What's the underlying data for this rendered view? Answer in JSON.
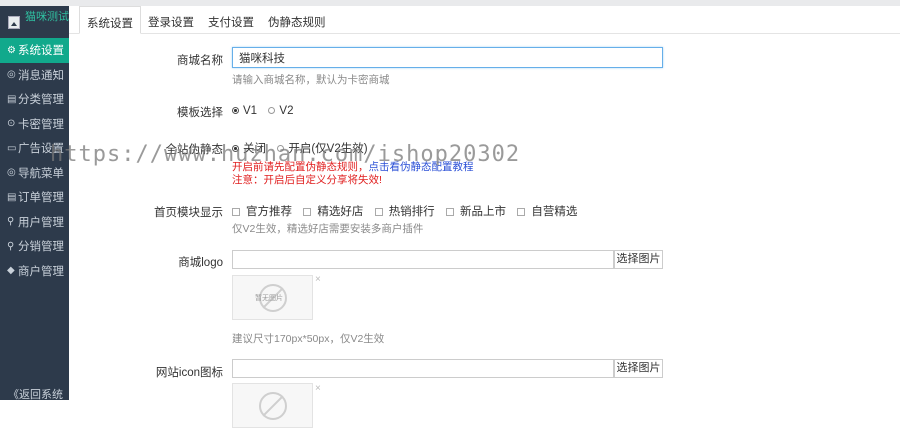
{
  "brand": {
    "name": "猫咪测试"
  },
  "sidebar": {
    "items": [
      {
        "icon": "⚙",
        "label": "系统设置",
        "active": true
      },
      {
        "icon": "◎",
        "label": "消息通知"
      },
      {
        "icon": "▤",
        "label": "分类管理"
      },
      {
        "icon": "⊙",
        "label": "卡密管理"
      },
      {
        "icon": "▭",
        "label": "广告设置"
      },
      {
        "icon": "◎",
        "label": "导航菜单"
      },
      {
        "icon": "▤",
        "label": "订单管理"
      },
      {
        "icon": "⚲",
        "label": "用户管理"
      },
      {
        "icon": "⚲",
        "label": "分销管理"
      },
      {
        "icon": "◆",
        "label": "商户管理"
      }
    ],
    "back_label": "《返回系统"
  },
  "tabs": [
    {
      "label": "系统设置",
      "active": true
    },
    {
      "label": "登录设置"
    },
    {
      "label": "支付设置"
    },
    {
      "label": "伪静态规则"
    }
  ],
  "form": {
    "shop_name": {
      "label": "商城名称",
      "value": "猫咪科技",
      "help": "请输入商城名称，默认为卡密商城"
    },
    "template": {
      "label": "模板选择",
      "options": [
        "V1",
        "V2"
      ],
      "selected": "V1"
    },
    "pseudo_static": {
      "label": "全站伪静态",
      "options": [
        "关闭",
        "开启(仅V2生效)"
      ],
      "selected": "关闭",
      "note_red": "开启前请先配置伪静态规则",
      "note_link": "点击看伪静态配置教程",
      "warning": "注意：开启后自定义分享将失效!"
    },
    "home_modules": {
      "label": "首页模块显示",
      "options": [
        "官方推荐",
        "精选好店",
        "热销排行",
        "新品上市",
        "自营精选"
      ],
      "help": "仅V2生效，精选好店需要安装多商户插件"
    },
    "logo": {
      "label": "商城logo",
      "button": "选择图片",
      "placeholder_text": "暂无图片",
      "remove": "×",
      "help": "建议尺寸170px*50px，仅V2生效"
    },
    "icon": {
      "label": "网站icon图标",
      "button": "选择图片",
      "remove": "×"
    }
  },
  "watermark": "https://www.huzhan.com/ishop20302"
}
